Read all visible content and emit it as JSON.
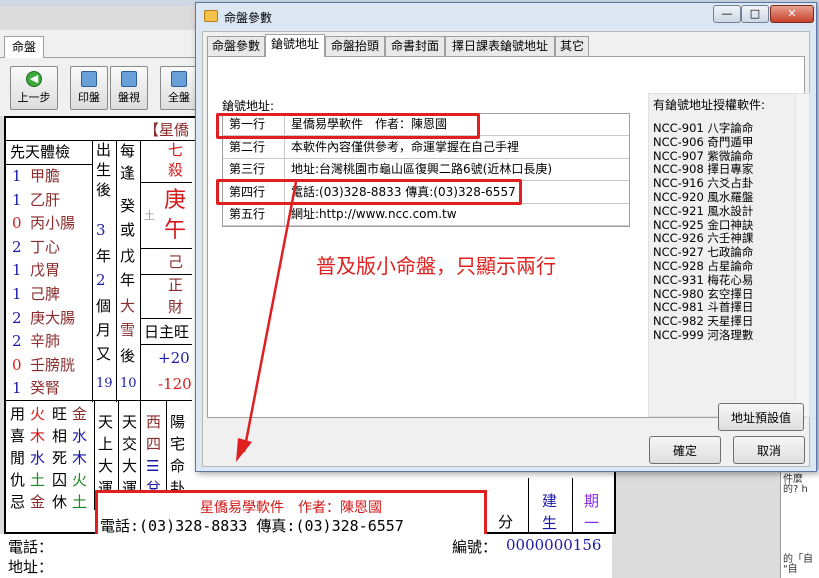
{
  "background_app": {
    "tab_label": "命盤",
    "toolbar": [
      {
        "id": "back",
        "label": "上一步",
        "icon": "back-arrow-icon"
      },
      {
        "id": "print",
        "label": "印盤",
        "icon": "print-icon"
      },
      {
        "id": "view",
        "label": "盤視",
        "icon": "view-icon"
      },
      {
        "id": "full",
        "label": "全盤",
        "icon": "full-icon"
      }
    ],
    "chart_header": "【星僑",
    "col1_header": "先天體檢",
    "col1_rows": [
      {
        "num": "1",
        "text": "甲膽",
        "num_color": "#1a1aa8",
        "text_color": "#8b2d2d"
      },
      {
        "num": "1",
        "text": "乙肝",
        "num_color": "#1a1aa8",
        "text_color": "#8b2d2d"
      },
      {
        "num": "0",
        "text": "丙小腸",
        "num_color": "#d41a1a",
        "text_color": "#8b2d2d"
      },
      {
        "num": "2",
        "text": "丁心",
        "num_color": "#1a1aa8",
        "text_color": "#8b2d2d"
      },
      {
        "num": "1",
        "text": "戊胃",
        "num_color": "#1a1aa8",
        "text_color": "#8b2d2d"
      },
      {
        "num": "1",
        "text": "己脾",
        "num_color": "#1a1aa8",
        "text_color": "#8b2d2d"
      },
      {
        "num": "2",
        "text": "庚大腸",
        "num_color": "#1a1aa8",
        "text_color": "#8b2d2d"
      },
      {
        "num": "2",
        "text": "辛肺",
        "num_color": "#1a1aa8",
        "text_color": "#8b2d2d"
      },
      {
        "num": "0",
        "text": "壬膀胱",
        "num_color": "#d41a1a",
        "text_color": "#8b2d2d"
      },
      {
        "num": "1",
        "text": "癸腎",
        "num_color": "#1a1aa8",
        "text_color": "#8b2d2d"
      }
    ],
    "col2_text": "出生後",
    "col2_values": [
      "3",
      "年",
      "2",
      "個",
      "月",
      "又",
      "19"
    ],
    "col3_text": "每逢",
    "col3_values": [
      "癸",
      "或",
      "戊",
      "年",
      "大",
      "雪",
      "後",
      "10"
    ],
    "pillar": {
      "top": "七殺",
      "stem": "庚",
      "branch": "午",
      "hidden": "己",
      "god1": "正",
      "god2": "財",
      "element": "土"
    },
    "day_master": "日主旺",
    "score_pos": "+20",
    "score_neg": "-120",
    "status_grid": [
      [
        "用",
        "火",
        "旺",
        "金"
      ],
      [
        "喜",
        "木",
        "相",
        "水"
      ],
      [
        "閒",
        "水",
        "死",
        "木"
      ],
      [
        "仇",
        "土",
        "囚",
        "火"
      ],
      [
        "忌",
        "金",
        "休",
        "土"
      ]
    ],
    "heavens_col": [
      "天",
      "上",
      "大",
      "運"
    ],
    "cross_col": [
      "天",
      "交",
      "大",
      "運"
    ],
    "west_col": [
      "西",
      "四",
      "☰",
      "兌"
    ],
    "yang_col": [
      "陽",
      "宅",
      "命",
      "卦"
    ],
    "right_bottom": [
      {
        "text": "建生",
        "color": "#1a1aa8"
      },
      {
        "text": "期一",
        "color": "#8a2be2"
      }
    ],
    "fen_label": "分",
    "bottom_line1": "星僑易學軟件　作者：陳恩國",
    "bottom_line2": "電話:(03)328-8833 傳真:(03)328-6557",
    "footer_phone_label": "電話：",
    "footer_addr_label": "地址：",
    "footer_serial_label": "編號：",
    "footer_serial_value": "0000000156",
    "right_panel_lines": [
      "件麼",
      "的? h",
      "",
      "",
      "",
      "",
      "",
      "",
      "的「自",
      "\"自"
    ]
  },
  "dialog": {
    "title": "命盤參數",
    "window_buttons": {
      "minimize": "—",
      "maximize": "□",
      "close": "✕"
    },
    "tabs": [
      "命盤參數",
      "鎗號地址",
      "命盤抬頭",
      "命書封面",
      "擇日課表鎗號地址",
      "其它"
    ],
    "active_tab": 1,
    "addr_label": "鎗號地址:",
    "rows": [
      {
        "label": "第一行",
        "value": "星僑易學軟件　作者：陳恩國"
      },
      {
        "label": "第二行",
        "value": "本軟件內容僅供參考，命運掌握在自己手裡"
      },
      {
        "label": "第三行",
        "value": "地址:台灣桃園市龜山區復興二路6號(近林口長庚)"
      },
      {
        "label": "第四行",
        "value": "電話:(03)328-8833 傳真:(03)328-6557"
      },
      {
        "label": "第五行",
        "value": "網址:http://www.ncc.com.tw"
      }
    ],
    "auth_title": "有鎗號地址授權軟件:",
    "auth_list": [
      "NCC-901 八字論命",
      "NCC-906 奇門遁甲",
      "NCC-907 紫微論命",
      "NCC-908 擇日專家",
      "NCC-916 六爻占卦",
      "NCC-920 風水羅盤",
      "NCC-921 風水設計",
      "NCC-925 金口神訣",
      "NCC-926 六壬神課",
      "NCC-927 七政論命",
      "NCC-928 占星論命",
      "NCC-931 梅花心易",
      "NCC-980 玄空擇日",
      "NCC-981 斗首擇日",
      "NCC-982 天星擇日",
      "NCC-999 河洛理數"
    ],
    "default_button": "地址預設值",
    "ok_button": "確定",
    "cancel_button": "取消"
  },
  "annotation": "普及版小命盤，只顯示兩行",
  "colors": {
    "highlight": "#e02020",
    "accent_blue": "#1a1aa8",
    "brown": "#8b2d2d"
  }
}
